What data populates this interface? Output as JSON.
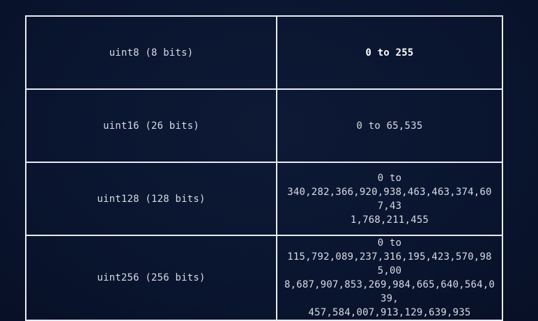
{
  "table": {
    "rows": [
      {
        "type": "uint8 (8 bits)",
        "range": "0 to 255",
        "emphasis": true
      },
      {
        "type": "uint16 (26 bits)",
        "range": "0 to 65,535",
        "emphasis": false
      },
      {
        "type": "uint128 (128 bits)",
        "range": "0 to\n340,282,366,920,938,463,463,374,607,43\n1,768,211,455",
        "emphasis": false
      },
      {
        "type": "uint256 (256 bits)",
        "range": "0 to\n115,792,089,237,316,195,423,570,985,00\n8,687,907,853,269,984,665,640,564,039,\n457,584,007,913,129,639,935",
        "emphasis": false
      }
    ]
  },
  "colors": {
    "background": "#0a1530",
    "border": "#e9ecf2",
    "text": "#d7dbe4"
  }
}
